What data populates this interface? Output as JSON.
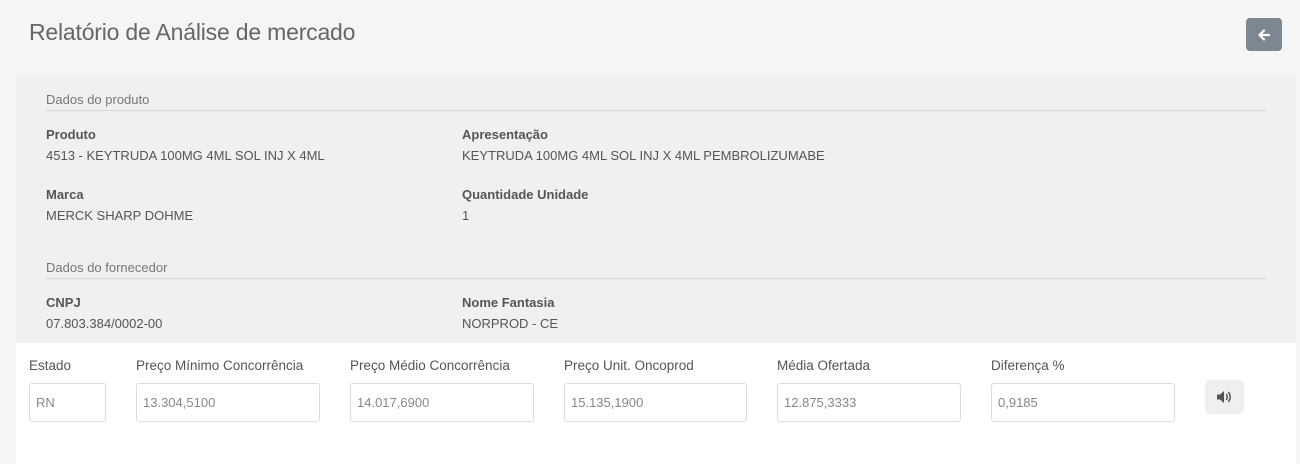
{
  "header": {
    "title": "Relatório de Análise de mercado",
    "back_icon": "arrow-left-icon"
  },
  "produto_section": {
    "title": "Dados do produto",
    "produto": {
      "label": "Produto",
      "value": "4513 - KEYTRUDA 100MG 4ML SOL INJ X 4ML"
    },
    "apresentacao": {
      "label": "Apresentação",
      "value": "KEYTRUDA 100MG 4ML SOL INJ X 4ML PEMBROLIZUMABE"
    },
    "marca": {
      "label": "Marca",
      "value": "MERCK SHARP DOHME"
    },
    "quantidade": {
      "label": "Quantidade Unidade",
      "value": "1"
    }
  },
  "fornecedor_section": {
    "title": "Dados do fornecedor",
    "cnpj": {
      "label": "CNPJ",
      "value": "07.803.384/0002-00"
    },
    "nome_fantasia": {
      "label": "Nome Fantasia",
      "value": "NORPROD - CE"
    }
  },
  "form": {
    "estado": {
      "label": "Estado",
      "value": "RN"
    },
    "preco_minimo": {
      "label": "Preço Mínimo Concorrência",
      "value": "13.304,5100"
    },
    "preco_medio": {
      "label": "Preço Médio Concorrência",
      "value": "14.017,6900"
    },
    "preco_unit": {
      "label": "Preço Unit. Oncoprod",
      "value": "15.135,1900"
    },
    "media_ofertada": {
      "label": "Média Ofertada",
      "value": "12.875,3333"
    },
    "diferenca": {
      "label": "Diferença %",
      "value": "0,9185"
    },
    "audio_icon": "volume-icon"
  },
  "colors": {
    "back_button": "#7c8791",
    "info_panel_bg": "#f0f0f0",
    "page_bg": "#f5f5f5"
  }
}
